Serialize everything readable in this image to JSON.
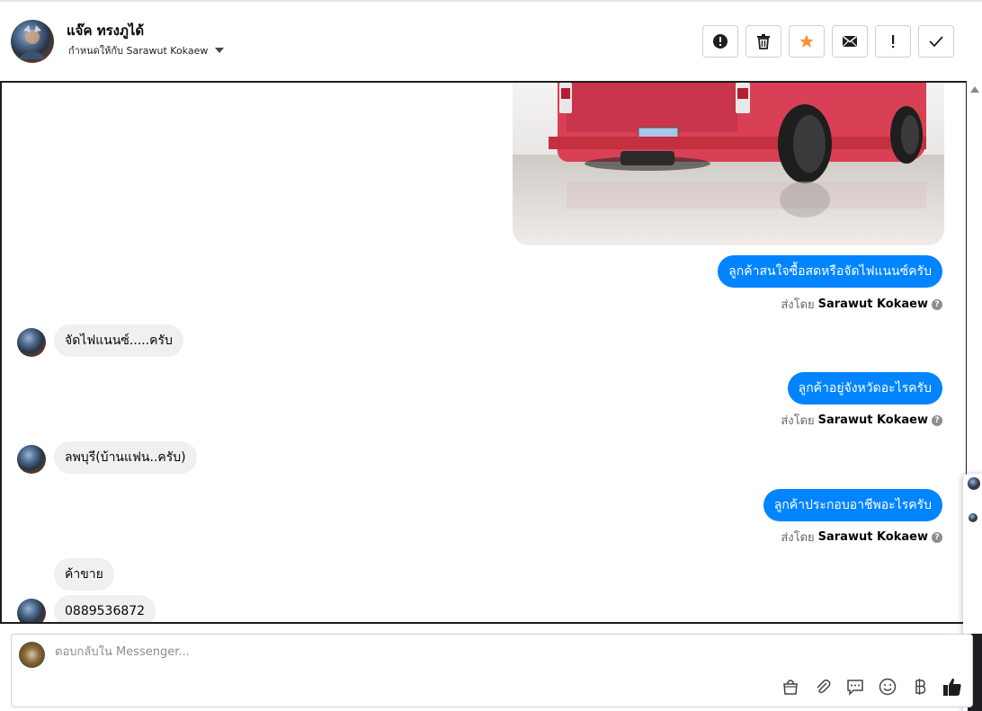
{
  "header": {
    "contact_name": "แจ๊ค ทรงภูได้",
    "assigned_to": "กำหนดให้กับ Sarawut Kokaew"
  },
  "actions": [
    {
      "name": "mark-spam-button",
      "icon": "alert-circle-icon"
    },
    {
      "name": "delete-button",
      "icon": "trash-icon"
    },
    {
      "name": "star-button",
      "icon": "star-icon",
      "color": "#f7923b"
    },
    {
      "name": "mark-unread-button",
      "icon": "envelope-icon"
    },
    {
      "name": "follow-up-button",
      "icon": "exclamation-icon"
    },
    {
      "name": "mark-done-button",
      "icon": "check-icon"
    }
  ],
  "messages": {
    "m1": "ลูกค้าสนใจซื้อสดหรือจัดไฟแนนซ์ครับ",
    "m2": "จัดไฟแนนซ์.....ครับ",
    "m3": "ลูกค้าอยู่จังหวัดอะไรครับ",
    "m4": "ลพบุรี(บ้านแฟน..ครับ)",
    "m5": "ลูกค้าประกอบอาชีพอะไรครับ",
    "m6": "ค้าขาย",
    "m7": "0889536872"
  },
  "sent_by": {
    "prefix": "ส่งโดย",
    "name": "Sarawut Kokaew"
  },
  "composer": {
    "placeholder": "ตอบกลับใน Messenger..."
  },
  "colors": {
    "outgoing_bubble": "#0084ff",
    "incoming_bubble": "#f0f0f0",
    "star": "#f7923b"
  }
}
